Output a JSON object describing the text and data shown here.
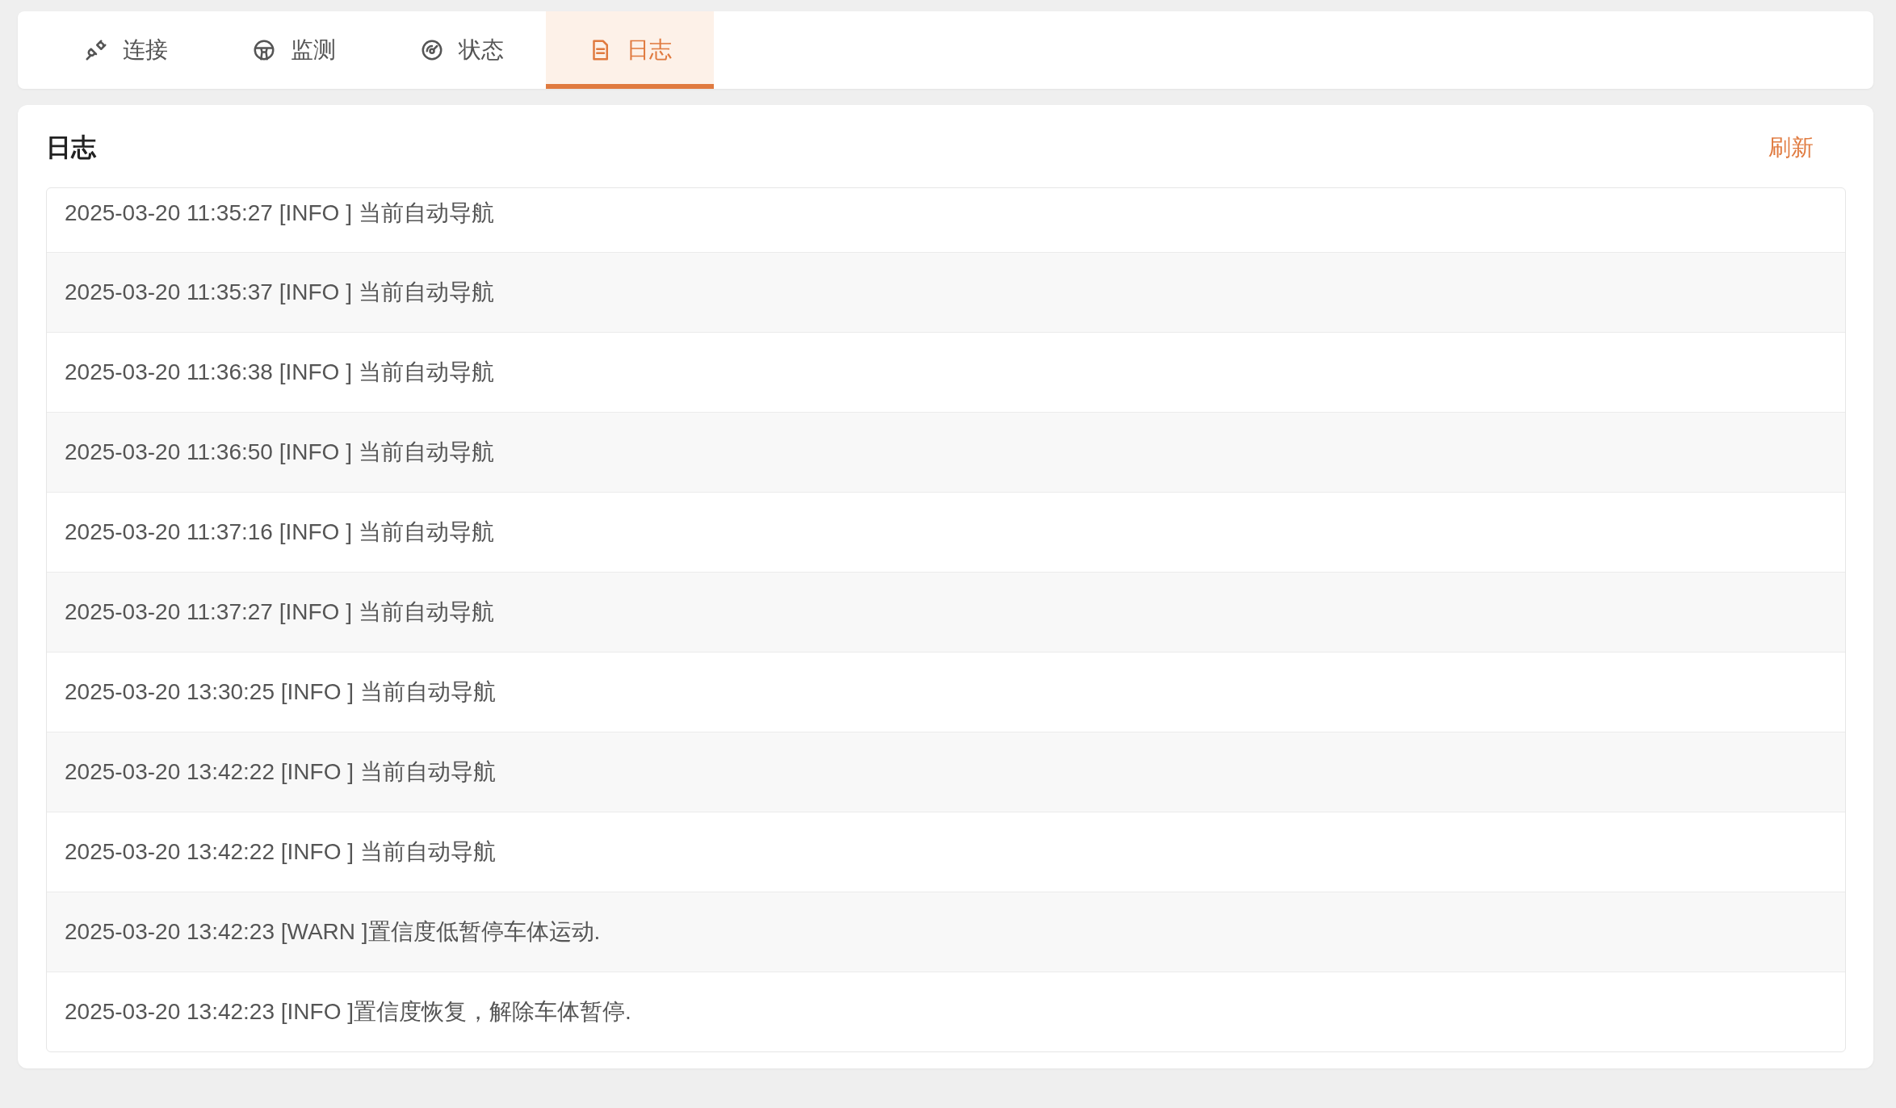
{
  "tabs": [
    {
      "label": "连接",
      "selected": false
    },
    {
      "label": "监测",
      "selected": false
    },
    {
      "label": "状态",
      "selected": false
    },
    {
      "label": "日志",
      "selected": true
    }
  ],
  "log_panel": {
    "title": "日志",
    "refresh_link": "刷新",
    "entries": [
      "2025-03-20 11:35:27 [INFO ] 当前自动导航",
      "2025-03-20 11:35:37 [INFO ] 当前自动导航",
      "2025-03-20 11:36:38 [INFO ] 当前自动导航",
      "2025-03-20 11:36:50 [INFO ] 当前自动导航",
      "2025-03-20 11:37:16 [INFO ] 当前自动导航",
      "2025-03-20 11:37:27 [INFO ] 当前自动导航",
      "2025-03-20 13:30:25 [INFO ] 当前自动导航",
      "2025-03-20 13:42:22 [INFO ] 当前自动导航",
      "2025-03-20 13:42:22 [INFO ] 当前自动导航",
      "2025-03-20 13:42:23 [WARN ]置信度低暂停车体运动.",
      "2025-03-20 13:42:23 [INFO ]置信度恢复，解除车体暂停."
    ]
  }
}
